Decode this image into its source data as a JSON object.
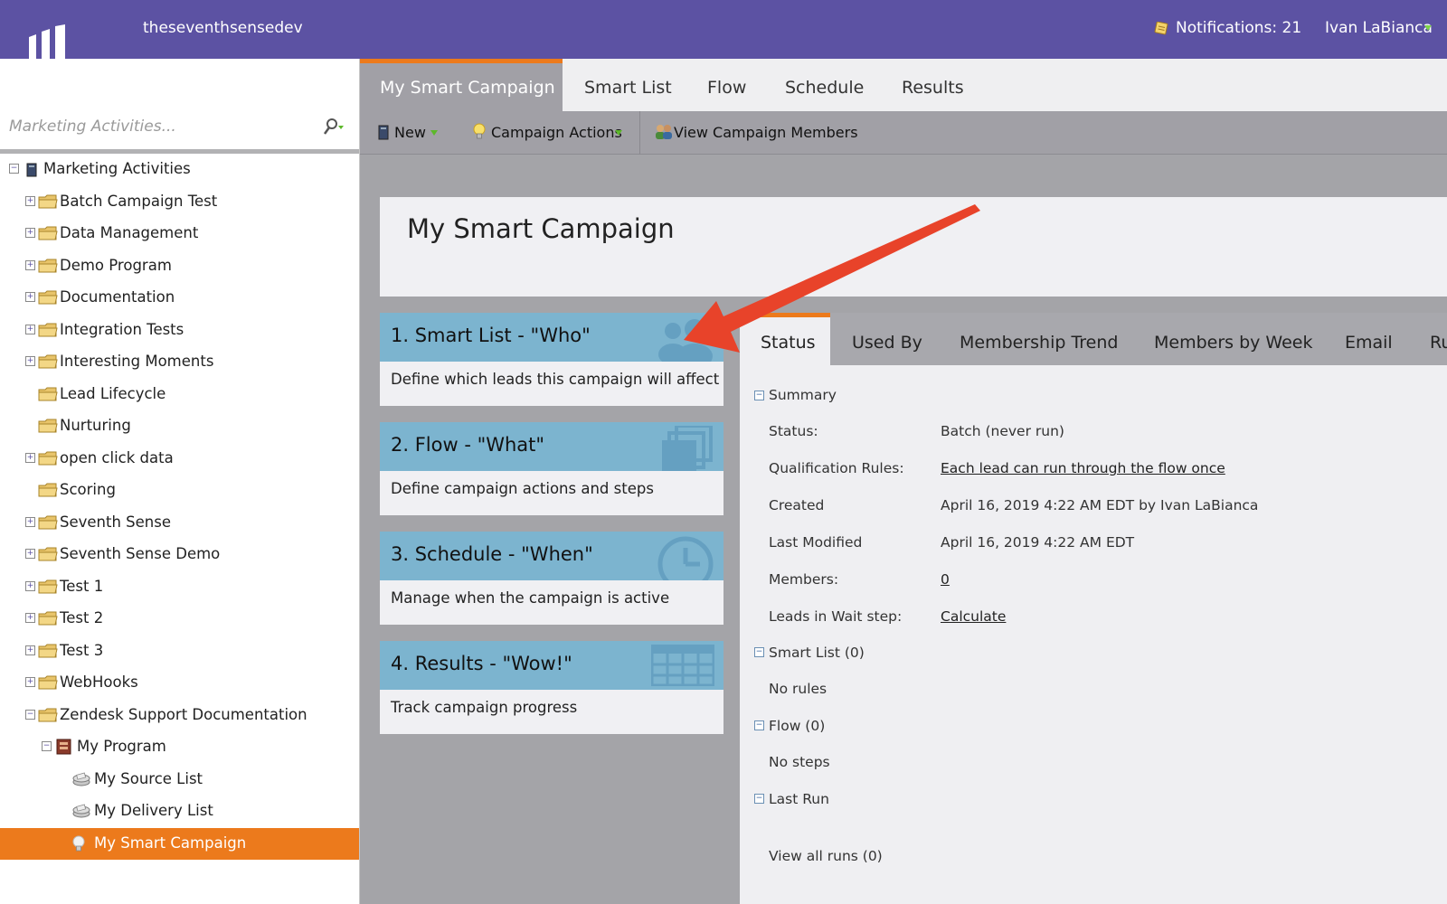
{
  "topbar": {
    "subscription": "theseventhsensedev",
    "notifications": "Notifications: 21",
    "user": "Ivan LaBianca",
    "accent": "#5c52a3"
  },
  "search": {
    "placeholder": "Marketing Activities..."
  },
  "tree": [
    {
      "label": "Marketing Activities",
      "level": 0,
      "toggle": "-",
      "icon": "root-icon"
    },
    {
      "label": "Batch Campaign Test",
      "level": 1,
      "toggle": "+",
      "icon": "folder-icon"
    },
    {
      "label": "Data Management",
      "level": 1,
      "toggle": "+",
      "icon": "folder-icon"
    },
    {
      "label": "Demo Program",
      "level": 1,
      "toggle": "+",
      "icon": "folder-icon"
    },
    {
      "label": "Documentation",
      "level": 1,
      "toggle": "+",
      "icon": "folder-icon"
    },
    {
      "label": "Integration Tests",
      "level": 1,
      "toggle": "+",
      "icon": "folder-icon"
    },
    {
      "label": "Interesting Moments",
      "level": 1,
      "toggle": "+",
      "icon": "folder-icon"
    },
    {
      "label": "Lead Lifecycle",
      "level": 1,
      "toggle": "",
      "icon": "folder-icon"
    },
    {
      "label": "Nurturing",
      "level": 1,
      "toggle": "",
      "icon": "folder-icon"
    },
    {
      "label": "open click data",
      "level": 1,
      "toggle": "+",
      "icon": "folder-icon"
    },
    {
      "label": "Scoring",
      "level": 1,
      "toggle": "",
      "icon": "folder-icon"
    },
    {
      "label": "Seventh Sense",
      "level": 1,
      "toggle": "+",
      "icon": "folder-icon"
    },
    {
      "label": "Seventh Sense Demo",
      "level": 1,
      "toggle": "+",
      "icon": "folder-icon"
    },
    {
      "label": "Test 1",
      "level": 1,
      "toggle": "+",
      "icon": "folder-icon"
    },
    {
      "label": "Test 2",
      "level": 1,
      "toggle": "+",
      "icon": "folder-icon"
    },
    {
      "label": "Test 3",
      "level": 1,
      "toggle": "+",
      "icon": "folder-icon"
    },
    {
      "label": "WebHooks",
      "level": 1,
      "toggle": "+",
      "icon": "folder-icon"
    },
    {
      "label": "Zendesk Support Documentation",
      "level": 1,
      "toggle": "-",
      "icon": "folder-icon"
    },
    {
      "label": "My Program",
      "level": 2,
      "toggle": "-",
      "icon": "program-icon"
    },
    {
      "label": "My Source List",
      "level": 3,
      "toggle": "",
      "icon": "list-icon"
    },
    {
      "label": "My Delivery List",
      "level": 3,
      "toggle": "",
      "icon": "list-icon"
    },
    {
      "label": "My Smart Campaign",
      "level": 3,
      "toggle": "",
      "icon": "lightbulb-icon",
      "selected": true
    }
  ],
  "maintabs": [
    "My Smart Campaign",
    "Smart List",
    "Flow",
    "Schedule",
    "Results"
  ],
  "toolbar": {
    "new_label": "New",
    "actions_label": "Campaign Actions",
    "members_label": "View Campaign Members"
  },
  "header": {
    "title": "My Smart Campaign"
  },
  "steps": [
    {
      "title": "1. Smart List - \"Who\"",
      "desc": "Define which leads this campaign will affect",
      "icon": "people-icon"
    },
    {
      "title": "2. Flow - \"What\"",
      "desc": "Define campaign actions and steps",
      "icon": "stack-icon"
    },
    {
      "title": "3. Schedule - \"When\"",
      "desc": "Manage when the campaign is active",
      "icon": "clock-icon"
    },
    {
      "title": "4. Results - \"Wow!\"",
      "desc": "Track campaign progress",
      "icon": "grid-icon"
    }
  ],
  "rtabs": [
    "Status",
    "Used By",
    "Membership Trend",
    "Members by Week",
    "Email",
    "Ru"
  ],
  "summary": {
    "title": "Summary",
    "rows": [
      {
        "label": "Status:",
        "value": "Batch (never run)",
        "link": false
      },
      {
        "label": "Qualification Rules:",
        "value": "Each lead can run through the flow once",
        "link": true
      },
      {
        "label": "Created",
        "value": "April 16, 2019 4:22 AM EDT by Ivan LaBianca",
        "link": false
      },
      {
        "label": "Last Modified",
        "value": "April 16, 2019 4:22 AM EDT",
        "link": false
      },
      {
        "label": "Members:",
        "value": "0",
        "link": true
      },
      {
        "label": "Leads in Wait step:",
        "value": "Calculate",
        "link": true
      }
    ]
  },
  "smartlist": {
    "title": "Smart List (0)",
    "text": "No rules"
  },
  "flow": {
    "title": "Flow (0)",
    "text": "No steps"
  },
  "lastrun": {
    "title": "Last Run",
    "text": "View all runs (0)"
  },
  "colors": {
    "orange": "#ec7a1c",
    "purple": "#5c52a3",
    "stepblue": "#7cb4cf",
    "arrow": "#e8432a"
  }
}
